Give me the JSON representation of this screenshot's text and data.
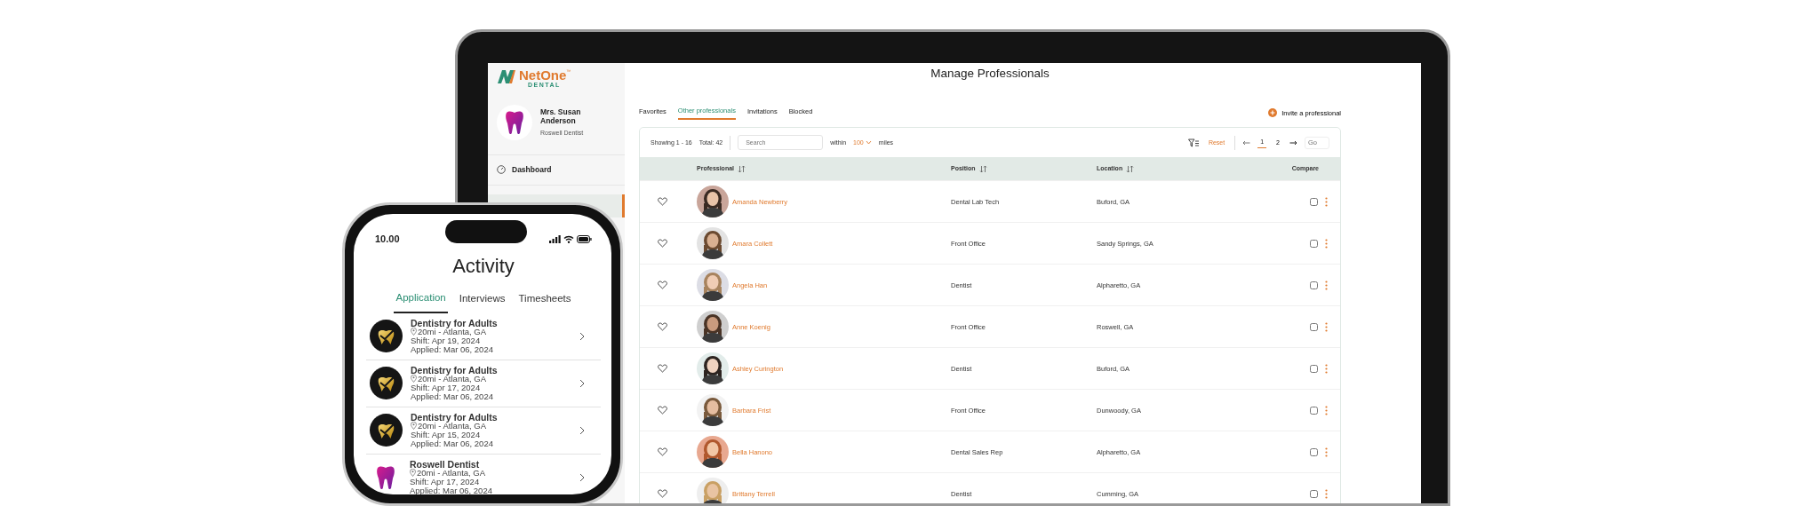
{
  "laptop": {
    "logo": {
      "name": "NetOne",
      "trademark": "™",
      "subtitle": "DENTAL"
    },
    "profile": {
      "name": "Mrs. Susan Anderson",
      "role": "Roswell Dentist"
    },
    "nav": [
      {
        "label": "Dashboard",
        "selected": false
      }
    ],
    "title": "Manage Professionals",
    "tabs": [
      {
        "label": "Favorites",
        "selected": false
      },
      {
        "label": "Other professionals",
        "selected": true
      },
      {
        "label": "Invitations",
        "selected": false
      },
      {
        "label": "Blocked",
        "selected": false
      }
    ],
    "invite": "Invite a professional",
    "toolbar": {
      "showing": "Showing 1 - 16",
      "total": "Total: 42",
      "search_placeholder": "Search",
      "within": "within",
      "distance": "100",
      "miles": "miles",
      "reset": "Reset",
      "pages": [
        {
          "label": "1",
          "selected": true
        },
        {
          "label": "2",
          "selected": false
        }
      ],
      "go_placeholder": "Go"
    },
    "columns": [
      {
        "label": "Professional",
        "sortable": true
      },
      {
        "label": "Position",
        "sortable": true
      },
      {
        "label": "Location",
        "sortable": true
      },
      {
        "label": "Compare",
        "sortable": false
      }
    ],
    "rows": [
      {
        "name": "Amanda Newberry",
        "position": "Dental Lab Tech",
        "location": "Buford, GA",
        "compare": false
      },
      {
        "name": "Amara Collett",
        "position": "Front Office",
        "location": "Sandy Springs, GA",
        "compare": false
      },
      {
        "name": "Angela Han",
        "position": "Dentist",
        "location": "Alpharetto, GA",
        "compare": false
      },
      {
        "name": "Anne Koenig",
        "position": "Front Office",
        "location": "Roswell, GA",
        "compare": false
      },
      {
        "name": "Ashley Curington",
        "position": "Dentist",
        "location": "Buford, GA",
        "compare": false
      },
      {
        "name": "Barbara Frist",
        "position": "Front Office",
        "location": "Dunwoody, GA",
        "compare": false
      },
      {
        "name": "Bella Hanono",
        "position": "Dental Sales Rep",
        "location": "Alpharetto, GA",
        "compare": false
      },
      {
        "name": "Brittany Terrell",
        "position": "Dentist",
        "location": "Cumming, GA",
        "compare": false
      }
    ]
  },
  "phone": {
    "time": "10.00",
    "title": "Activity",
    "tabs": [
      {
        "label": "Application",
        "selected": true
      },
      {
        "label": "Interviews",
        "selected": false
      },
      {
        "label": "Timesheets",
        "selected": false
      }
    ],
    "items": [
      {
        "kind": "clinic-logo",
        "title": "Dentistry for Adults",
        "location": "20mi - Atlanta, GA",
        "shift": "Shift: Apr 19, 2024",
        "applied": "Applied: Mar 06, 2024"
      },
      {
        "kind": "clinic-logo",
        "title": "Dentistry for Adults",
        "location": "20mi - Atlanta, GA",
        "shift": "Shift: Apr 17, 2024",
        "applied": "Applied: Mar 06, 2024"
      },
      {
        "kind": "clinic-logo",
        "title": "Dentistry for Adults",
        "location": "20mi - Atlanta, GA",
        "shift": "Shift: Apr 15, 2024",
        "applied": "Applied: Mar 06, 2024"
      },
      {
        "kind": "tooth-logo",
        "title": "Roswell Dentist",
        "location": "20mi - Atlanta, GA",
        "shift": "Shift: Apr 17, 2024",
        "applied": "Applied: Mar 06, 2024"
      }
    ]
  }
}
